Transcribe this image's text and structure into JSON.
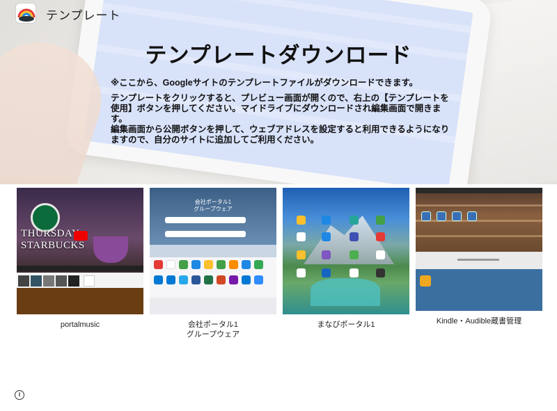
{
  "header": {
    "site_title": "テンプレート",
    "logo_icon": "rainbow-cloud-icon"
  },
  "hero": {
    "title": "テンプレートダウンロード",
    "paragraphs": [
      "※ここから、Googleサイトのテンプレートファイルがダウンロードできます。",
      "テンプレートをクリックすると、プレビュー画面が開くので、右上の【テンプレートを使用】ボタンを押してください。マイドライブにダウンロードされ編集画面で開きます。",
      "編集画面から公開ボタンを押して、ウェブアドレスを設定すると利用できるようになりますので、自分のサイトに追加してご利用ください。"
    ]
  },
  "templates": [
    {
      "caption_line1": "portalmusic",
      "caption_line2": "",
      "thumb_banner": "THURSDAY STARBUCKS"
    },
    {
      "caption_line1": "会社ポータル1",
      "caption_line2": "グループウェア",
      "thumb_title1": "会社ポータル1",
      "thumb_title2": "グループウェア"
    },
    {
      "caption_line1": "まなびポータル1",
      "caption_line2": ""
    },
    {
      "caption_line1": "Kindle・Audible蔵書管理",
      "caption_line2": ""
    }
  ],
  "footer": {
    "info_icon": "info-icon",
    "info_glyph": "i"
  },
  "colors": {
    "hero_screen": "#b9cbf4",
    "kindle_bg": "#3a6fa0",
    "portalmusic_bg": "#6a3d12"
  }
}
